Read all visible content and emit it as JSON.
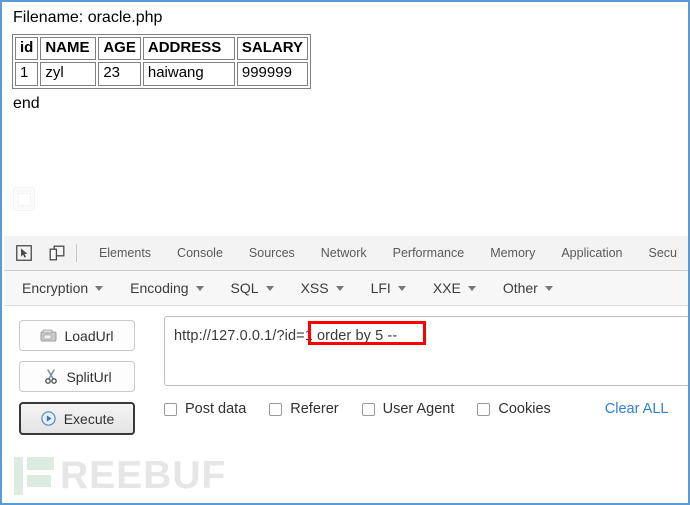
{
  "page": {
    "filename_line": "Filename: oracle.php",
    "table": {
      "headers": [
        "id",
        "NAME",
        "AGE",
        "ADDRESS",
        "SALARY"
      ],
      "rows": [
        [
          "1",
          "zyl",
          "23",
          "haiwang",
          "999999"
        ]
      ]
    },
    "end_line": "end"
  },
  "devtools": {
    "icons": {
      "inspect": "inspect-element-icon",
      "device": "device-toolbar-icon"
    },
    "tabs": [
      {
        "label": "Elements"
      },
      {
        "label": "Console"
      },
      {
        "label": "Sources"
      },
      {
        "label": "Network"
      },
      {
        "label": "Performance"
      },
      {
        "label": "Memory"
      },
      {
        "label": "Application"
      },
      {
        "label": "Secu"
      }
    ]
  },
  "hackbar": {
    "menus": [
      {
        "label": "Encryption"
      },
      {
        "label": "Encoding"
      },
      {
        "label": "SQL"
      },
      {
        "label": "XSS"
      },
      {
        "label": "LFI"
      },
      {
        "label": "XXE"
      },
      {
        "label": "Other"
      }
    ],
    "buttons": [
      {
        "label": "LoadUrl",
        "icon": "loadurl-icon"
      },
      {
        "label": "SplitUrl",
        "icon": "scissors-icon"
      },
      {
        "label": "Execute",
        "icon": "play-icon"
      }
    ],
    "url_field": {
      "value": "http://127.0.0.1/?id=1 order by 5 --",
      "placeholder": "http://",
      "highlight_text": "1 order by 5 --",
      "highlight_color": "#ff0000"
    },
    "options": [
      {
        "label": "Post data",
        "checked": false
      },
      {
        "label": "Referer",
        "checked": false
      },
      {
        "label": "User Agent",
        "checked": false
      },
      {
        "label": "Cookies",
        "checked": false
      }
    ],
    "clear_all_label": "Clear ALL",
    "clear_all_color": "#2e7fd4"
  },
  "watermark": {
    "text": "REEBUF",
    "mark_color": "#dcece0",
    "text_color": "#e6e6e6"
  }
}
